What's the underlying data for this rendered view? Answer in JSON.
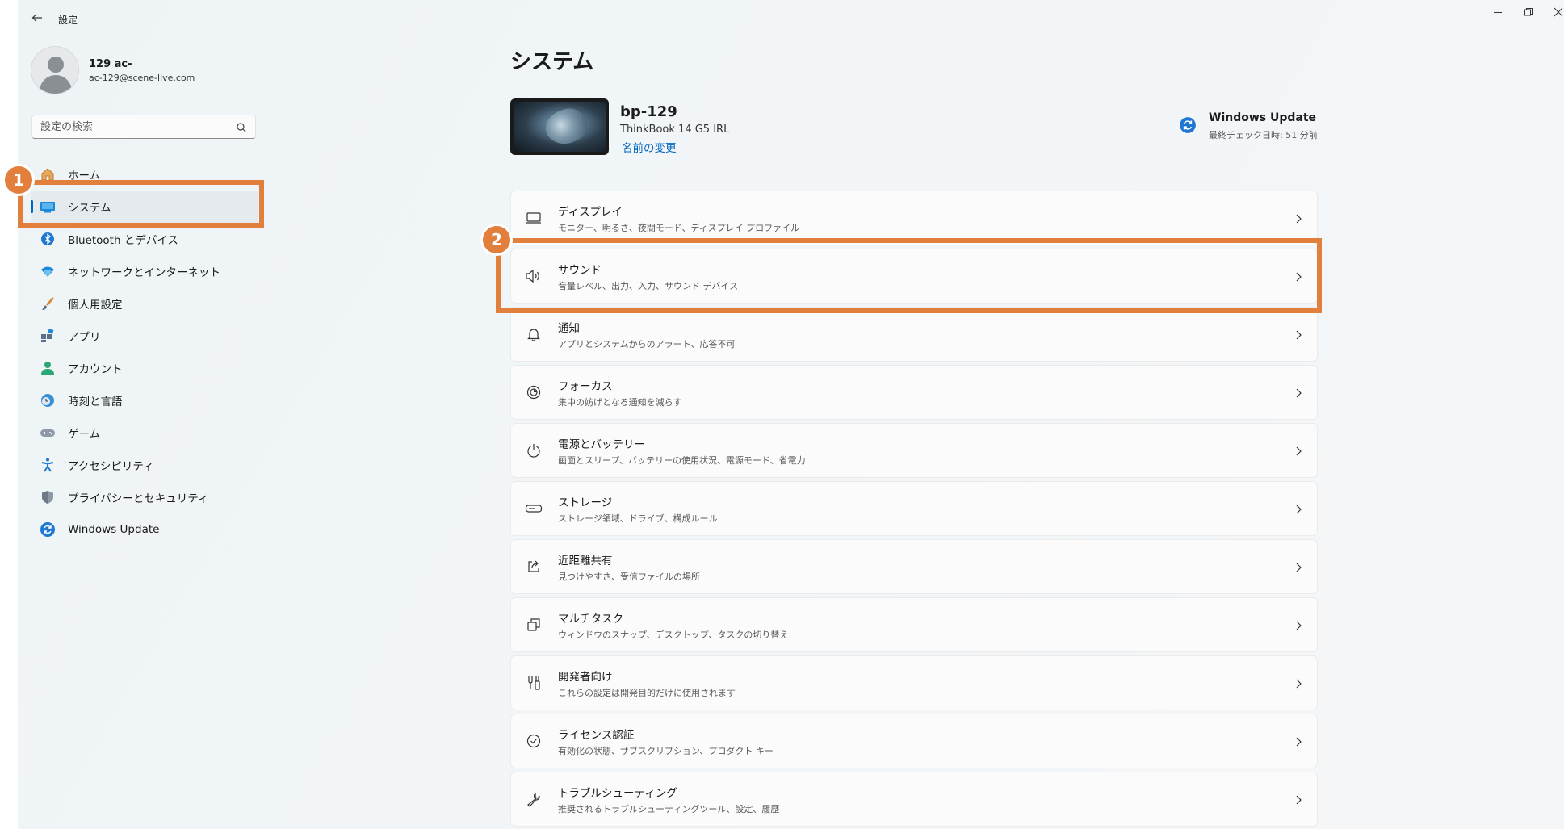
{
  "window": {
    "title": "設定",
    "back_icon": "back-arrow-icon",
    "controls": [
      "minimize-icon",
      "restore-icon",
      "close-icon"
    ]
  },
  "user": {
    "name": "129 ac-",
    "email": "ac-129@scene-live.com"
  },
  "search": {
    "placeholder": "設定の検索"
  },
  "sidebar": {
    "items": [
      {
        "label": "ホーム",
        "icon": "home-icon"
      },
      {
        "label": "システム",
        "icon": "system-icon",
        "active": true
      },
      {
        "label": "Bluetooth とデバイス",
        "icon": "bluetooth-icon"
      },
      {
        "label": "ネットワークとインターネット",
        "icon": "wifi-icon"
      },
      {
        "label": "個人用設定",
        "icon": "brush-icon"
      },
      {
        "label": "アプリ",
        "icon": "apps-icon"
      },
      {
        "label": "アカウント",
        "icon": "account-icon"
      },
      {
        "label": "時刻と言語",
        "icon": "time-language-icon"
      },
      {
        "label": "ゲーム",
        "icon": "gamepad-icon"
      },
      {
        "label": "アクセシビリティ",
        "icon": "accessibility-icon"
      },
      {
        "label": "プライバシーとセキュリティ",
        "icon": "shield-icon"
      },
      {
        "label": "Windows Update",
        "icon": "windows-update-icon"
      }
    ]
  },
  "main": {
    "title": "システム",
    "device": {
      "name": "bp-129",
      "model": "ThinkBook 14 G5 IRL",
      "rename_label": "名前の変更"
    },
    "windows_update": {
      "title": "Windows Update",
      "subtitle": "最終チェック日時: 51 分前"
    },
    "settings": [
      {
        "title": "ディスプレイ",
        "desc": "モニター、明るさ、夜間モード、ディスプレイ プロファイル",
        "icon": "display-icon"
      },
      {
        "title": "サウンド",
        "desc": "音量レベル、出力、入力、サウンド デバイス",
        "icon": "speaker-icon"
      },
      {
        "title": "通知",
        "desc": "アプリとシステムからのアラート、応答不可",
        "icon": "bell-icon"
      },
      {
        "title": "フォーカス",
        "desc": "集中の妨げとなる通知を減らす",
        "icon": "focus-icon"
      },
      {
        "title": "電源とバッテリー",
        "desc": "画面とスリープ、バッテリーの使用状況、電源モード、省電力",
        "icon": "power-icon"
      },
      {
        "title": "ストレージ",
        "desc": "ストレージ領域、ドライブ、構成ルール",
        "icon": "storage-icon"
      },
      {
        "title": "近距離共有",
        "desc": "見つけやすさ、受信ファイルの場所",
        "icon": "share-icon"
      },
      {
        "title": "マルチタスク",
        "desc": "ウィンドウのスナップ、デスクトップ、タスクの切り替え",
        "icon": "multitask-icon"
      },
      {
        "title": "開発者向け",
        "desc": "これらの設定は開発目的だけに使用されます",
        "icon": "developer-icon"
      },
      {
        "title": "ライセンス認証",
        "desc": "有効化の状態、サブスクリプション、プロダクト キー",
        "icon": "activation-icon"
      },
      {
        "title": "トラブルシューティング",
        "desc": "推奨されるトラブルシューティングツール、設定、履歴",
        "icon": "wrench-icon"
      }
    ]
  },
  "annotations": {
    "badge_1": "1",
    "badge_2": "2",
    "color": "#e27f3d"
  }
}
